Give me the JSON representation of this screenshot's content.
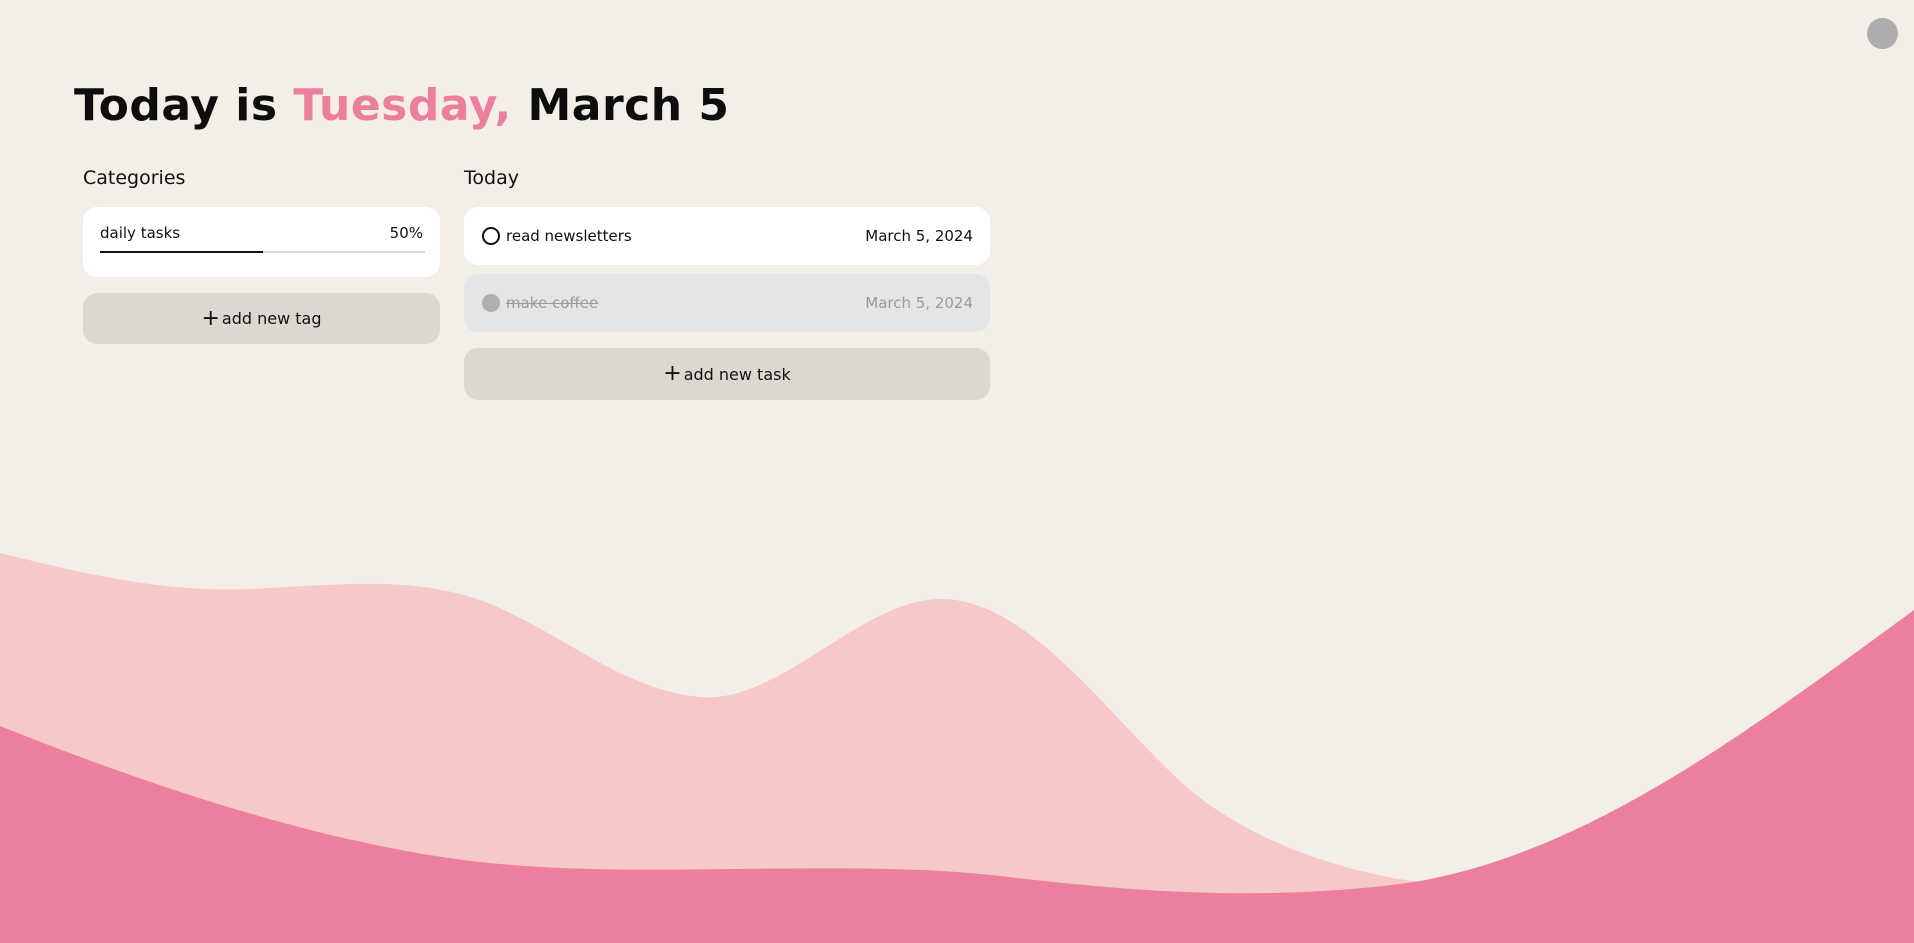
{
  "heading": {
    "prefix": "Today is ",
    "day": "Tuesday,",
    "date": " March 5"
  },
  "categories": {
    "label": "Categories",
    "tags": [
      {
        "name": "daily tasks",
        "percent_label": "50%",
        "progress": 0.5
      }
    ],
    "add_button_label": "add new tag"
  },
  "today": {
    "label": "Today",
    "tasks": [
      {
        "title": "read newsletters",
        "date": "March 5, 2024",
        "completed": false
      },
      {
        "title": "make coffee",
        "date": "March 5, 2024",
        "completed": true
      }
    ],
    "add_button_label": "add new task"
  },
  "colors": {
    "background": "#f3eee8",
    "accent_pink": "#ec7f9e",
    "light_pink": "#f6c8c7",
    "button_gray": "#dcd7d1"
  },
  "icons": {
    "add": "plus-icon",
    "task_open": "circle-outline-icon",
    "task_done": "circle-filled-icon",
    "profile": "avatar-icon"
  }
}
